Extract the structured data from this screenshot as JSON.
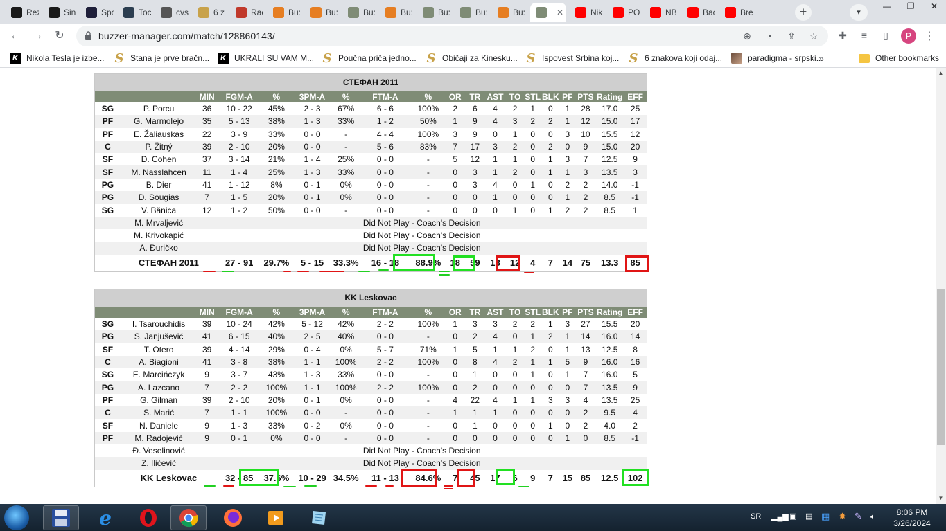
{
  "browser": {
    "tabs": [
      {
        "label": "Rez",
        "color": "#1a1a1a"
      },
      {
        "label": "Sin",
        "color": "#1a1a1a"
      },
      {
        "label": "Spo",
        "color": "#1f1f3a"
      },
      {
        "label": "Toc",
        "color": "#2c3e50"
      },
      {
        "label": "cvs",
        "color": "#555555"
      },
      {
        "label": "6 z",
        "color": "#c8a24a"
      },
      {
        "label": "Rac",
        "color": "#c0392b"
      },
      {
        "label": "Bu:",
        "color": "#e67e22"
      },
      {
        "label": "Bu:",
        "color": "#e67e22"
      },
      {
        "label": "Bu:",
        "color": "#7f8c76"
      },
      {
        "label": "Bu:",
        "color": "#e67e22"
      },
      {
        "label": "Bu:",
        "color": "#7f8c76"
      },
      {
        "label": "Bu:",
        "color": "#7f8c76"
      },
      {
        "label": "Bu:",
        "color": "#e67e22"
      },
      {
        "label": "",
        "color": "#7f8c76",
        "active": true
      },
      {
        "label": "Nik",
        "color": "#ff0000"
      },
      {
        "label": "PO",
        "color": "#ff0000"
      },
      {
        "label": "NB",
        "color": "#ff0000"
      },
      {
        "label": "Bac",
        "color": "#ff0000"
      },
      {
        "label": "Bre",
        "color": "#ff0000"
      }
    ],
    "url": "buzzer-manager.com/match/128860143/",
    "profile_initial": "P",
    "bookmarks": [
      {
        "label": "Nikola Tesla je izbe...",
        "icon": "k"
      },
      {
        "label": "Stana je prve bračn...",
        "icon": "s"
      },
      {
        "label": "UKRALI SU VAM M...",
        "icon": "k"
      },
      {
        "label": "Poučna priča jedno...",
        "icon": "s"
      },
      {
        "label": "Običaji za Kinesku...",
        "icon": "s"
      },
      {
        "label": "Ispovest Srbina koj...",
        "icon": "s"
      },
      {
        "label": "6 znakova koji odaj...",
        "icon": "s"
      },
      {
        "label": "paradigma - srpski...",
        "icon": "p"
      }
    ],
    "bookmarks_overflow": "»",
    "other_bookmarks": "Other bookmarks"
  },
  "headers": [
    "",
    "",
    "MIN",
    "FGM-A",
    "%",
    "3PM-A",
    "%",
    "FTM-A",
    "%",
    "OR",
    "TR",
    "AST",
    "TO",
    "STL",
    "BLK",
    "PF",
    "PTS",
    "Rating",
    "EFF"
  ],
  "teams": [
    {
      "name": "СТЕФАН 2011",
      "players": [
        [
          "SG",
          "P. Porcu",
          "36",
          "10 - 22",
          "45%",
          "2 - 3",
          "67%",
          "6 - 6",
          "100%",
          "2",
          "6",
          "4",
          "2",
          "1",
          "0",
          "1",
          "28",
          "17.0",
          "25"
        ],
        [
          "PF",
          "G. Marmolejo",
          "35",
          "5 - 13",
          "38%",
          "1 - 3",
          "33%",
          "1 - 2",
          "50%",
          "1",
          "9",
          "4",
          "3",
          "2",
          "2",
          "1",
          "12",
          "15.0",
          "17"
        ],
        [
          "PF",
          "E. Žaliauskas",
          "22",
          "3 - 9",
          "33%",
          "0 - 0",
          "-",
          "4 - 4",
          "100%",
          "3",
          "9",
          "0",
          "1",
          "0",
          "0",
          "3",
          "10",
          "15.5",
          "12"
        ],
        [
          "C",
          "P. Žitný",
          "39",
          "2 - 10",
          "20%",
          "0 - 0",
          "-",
          "5 - 6",
          "83%",
          "7",
          "17",
          "3",
          "2",
          "0",
          "2",
          "0",
          "9",
          "15.0",
          "20"
        ],
        [
          "SF",
          "D. Cohen",
          "37",
          "3 - 14",
          "21%",
          "1 - 4",
          "25%",
          "0 - 0",
          "-",
          "5",
          "12",
          "1",
          "1",
          "0",
          "1",
          "3",
          "7",
          "12.5",
          "9"
        ],
        [
          "SF",
          "M. Nasslahcen",
          "11",
          "1 - 4",
          "25%",
          "1 - 3",
          "33%",
          "0 - 0",
          "-",
          "0",
          "3",
          "1",
          "2",
          "0",
          "1",
          "1",
          "3",
          "13.5",
          "3"
        ],
        [
          "PG",
          "B. Dier",
          "41",
          "1 - 12",
          "8%",
          "0 - 1",
          "0%",
          "0 - 0",
          "-",
          "0",
          "3",
          "4",
          "0",
          "1",
          "0",
          "2",
          "2",
          "14.0",
          "-1"
        ],
        [
          "PG",
          "D. Sougias",
          "7",
          "1 - 5",
          "20%",
          "0 - 1",
          "0%",
          "0 - 0",
          "-",
          "0",
          "0",
          "1",
          "0",
          "0",
          "0",
          "1",
          "2",
          "8.5",
          "-1"
        ],
        [
          "SG",
          "V. Bănica",
          "12",
          "1 - 2",
          "50%",
          "0 - 0",
          "-",
          "0 - 0",
          "-",
          "0",
          "0",
          "0",
          "1",
          "0",
          "1",
          "2",
          "2",
          "8.5",
          "1"
        ]
      ],
      "dnp": [
        "M. Mrvaljević",
        "M. Krivokapić",
        "A. Đuričko"
      ],
      "dnp_text": "Did Not Play - Coach's Decision",
      "totals": [
        "",
        "СТЕФАН 2011",
        "",
        "27 - 91",
        "29.7%",
        "5 - 15",
        "33.3%",
        "16 - 18",
        "88.9%",
        "18",
        "59",
        "18",
        "12",
        "4",
        "7",
        "14",
        "75",
        "13.3",
        "85"
      ]
    },
    {
      "name": "KK Leskovac",
      "players": [
        [
          "SG",
          "I. Tsarouchidis",
          "39",
          "10 - 24",
          "42%",
          "5 - 12",
          "42%",
          "2 - 2",
          "100%",
          "1",
          "3",
          "3",
          "2",
          "2",
          "1",
          "3",
          "27",
          "15.5",
          "20"
        ],
        [
          "PG",
          "S. Janjušević",
          "41",
          "6 - 15",
          "40%",
          "2 - 5",
          "40%",
          "0 - 0",
          "-",
          "0",
          "2",
          "4",
          "0",
          "1",
          "2",
          "1",
          "14",
          "16.0",
          "14"
        ],
        [
          "SF",
          "T. Otero",
          "39",
          "4 - 14",
          "29%",
          "0 - 4",
          "0%",
          "5 - 7",
          "71%",
          "1",
          "5",
          "1",
          "1",
          "2",
          "0",
          "1",
          "13",
          "12.5",
          "8"
        ],
        [
          "C",
          "A. Biagioni",
          "41",
          "3 - 8",
          "38%",
          "1 - 1",
          "100%",
          "2 - 2",
          "100%",
          "0",
          "8",
          "4",
          "2",
          "1",
          "1",
          "5",
          "9",
          "16.0",
          "16"
        ],
        [
          "SG",
          "E. Marcińczyk",
          "9",
          "3 - 7",
          "43%",
          "1 - 3",
          "33%",
          "0 - 0",
          "-",
          "0",
          "1",
          "0",
          "0",
          "1",
          "0",
          "1",
          "7",
          "16.0",
          "5"
        ],
        [
          "PG",
          "A. Lazcano",
          "7",
          "2 - 2",
          "100%",
          "1 - 1",
          "100%",
          "2 - 2",
          "100%",
          "0",
          "2",
          "0",
          "0",
          "0",
          "0",
          "0",
          "7",
          "13.5",
          "9"
        ],
        [
          "PF",
          "G. Gilman",
          "39",
          "2 - 10",
          "20%",
          "0 - 1",
          "0%",
          "0 - 0",
          "-",
          "4",
          "22",
          "4",
          "1",
          "1",
          "3",
          "3",
          "4",
          "13.5",
          "25"
        ],
        [
          "C",
          "S. Marić",
          "7",
          "1 - 1",
          "100%",
          "0 - 0",
          "-",
          "0 - 0",
          "-",
          "1",
          "1",
          "1",
          "0",
          "0",
          "0",
          "0",
          "2",
          "9.5",
          "4"
        ],
        [
          "SF",
          "N. Daniele",
          "9",
          "1 - 3",
          "33%",
          "0 - 2",
          "0%",
          "0 - 0",
          "-",
          "0",
          "1",
          "0",
          "0",
          "0",
          "1",
          "0",
          "2",
          "4.0",
          "2"
        ],
        [
          "PF",
          "M. Radojević",
          "9",
          "0 - 1",
          "0%",
          "0 - 0",
          "-",
          "0 - 0",
          "-",
          "0",
          "0",
          "0",
          "0",
          "0",
          "0",
          "1",
          "0",
          "8.5",
          "-1"
        ]
      ],
      "dnp": [
        "Đ. Veselinović",
        "Z. Ilićević"
      ],
      "dnp_text": "Did Not Play - Coach's Decision",
      "totals": [
        "",
        "KK Leskovac",
        "",
        "32 - 85",
        "37.6%",
        "10 - 29",
        "34.5%",
        "11 - 13",
        "84.6%",
        "7",
        "45",
        "17",
        "6",
        "9",
        "7",
        "15",
        "85",
        "12.5",
        "102"
      ]
    }
  ],
  "taskbar": {
    "lang": "SR",
    "time": "8:06 PM",
    "date": "3/26/2024"
  }
}
